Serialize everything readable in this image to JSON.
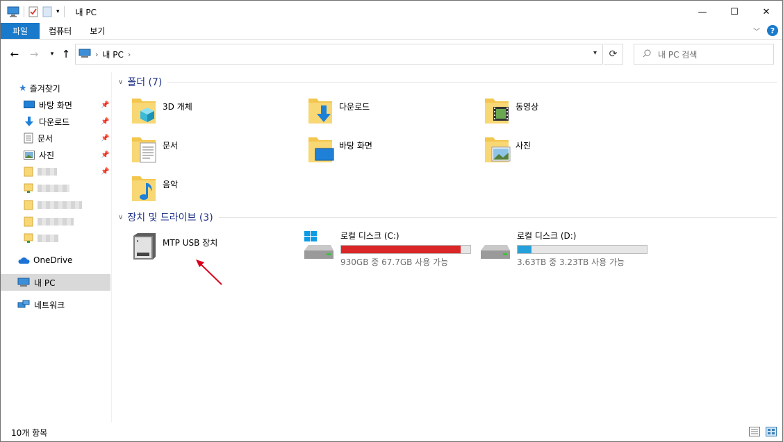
{
  "window": {
    "title": "내 PC"
  },
  "ribbon": {
    "tabs": [
      "파일",
      "컴퓨터",
      "보기"
    ],
    "help": "?"
  },
  "nav": {
    "breadcrumb": [
      "내 PC"
    ],
    "search_placeholder": "내 PC 검색"
  },
  "sidebar": {
    "quick_access": "즐겨찾기",
    "pinned": [
      {
        "label": "바탕 화면",
        "icon": "desktop-icon"
      },
      {
        "label": "다운로드",
        "icon": "download-icon"
      },
      {
        "label": "문서",
        "icon": "document-icon"
      },
      {
        "label": "사진",
        "icon": "pictures-icon"
      }
    ],
    "onedrive": "OneDrive",
    "this_pc": "내 PC",
    "network": "네트워크"
  },
  "folders_group": {
    "header": "폴더 (7)",
    "items": [
      "3D 개체",
      "다운로드",
      "동영상",
      "문서",
      "바탕 화면",
      "사진",
      "음악"
    ]
  },
  "devices_group": {
    "header": "장치 및 드라이브 (3)",
    "mtp": "MTP USB 장치",
    "drives": [
      {
        "name": "로컬 디스크 (C:)",
        "free": "930GB 중 67.7GB 사용 가능",
        "used_fraction": 0.927,
        "color": "#da2626"
      },
      {
        "name": "로컬 디스크 (D:)",
        "free": "3.63TB 중 3.23TB 사용 가능",
        "used_fraction": 0.11,
        "color": "#26a0da"
      }
    ]
  },
  "status": {
    "count": "10개 항목"
  },
  "colors": {
    "accent": "#1979ca",
    "header_text": "#1e3287",
    "annotation_arrow": "#d9001b"
  }
}
